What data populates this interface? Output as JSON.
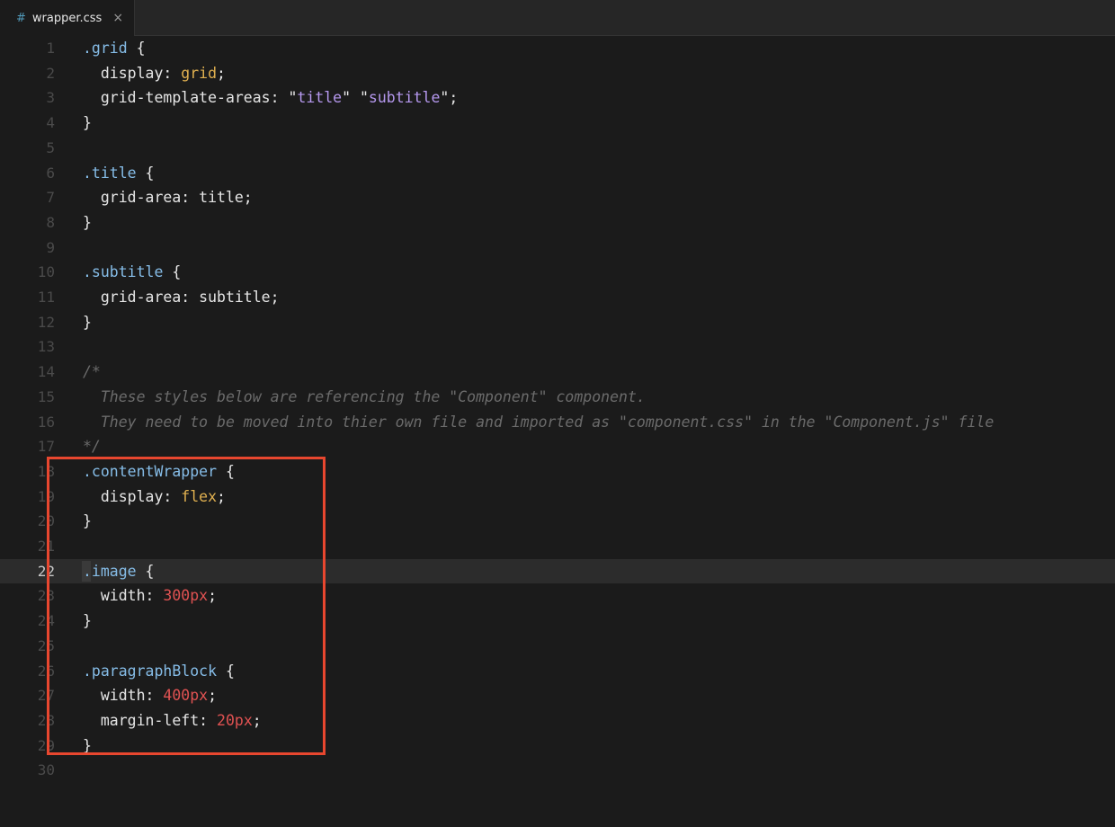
{
  "tab": {
    "icon": "#",
    "filename": "wrapper.css",
    "close": "×"
  },
  "colors": {
    "selector": "#86bde8",
    "keyword": "#e0b050",
    "string": "#b598ee",
    "number": "#e05252",
    "comment": "#6b6b6b",
    "annotation_box": "#e8472f"
  },
  "active_line": 22,
  "lines": [
    {
      "n": "1",
      "tokens": [
        [
          "sel",
          ".grid"
        ],
        [
          "punc",
          " {"
        ]
      ]
    },
    {
      "n": "2",
      "tokens": [
        [
          "prop",
          "  display: "
        ],
        [
          "kw",
          "grid"
        ],
        [
          "punc",
          ";"
        ]
      ]
    },
    {
      "n": "3",
      "tokens": [
        [
          "prop",
          "  grid-template-areas: "
        ],
        [
          "punc",
          "\""
        ],
        [
          "str",
          "title"
        ],
        [
          "punc",
          "\" \""
        ],
        [
          "str",
          "subtitle"
        ],
        [
          "punc",
          "\";"
        ]
      ]
    },
    {
      "n": "4",
      "tokens": [
        [
          "punc",
          "}"
        ]
      ]
    },
    {
      "n": "5",
      "tokens": []
    },
    {
      "n": "6",
      "tokens": [
        [
          "sel",
          ".title"
        ],
        [
          "punc",
          " {"
        ]
      ]
    },
    {
      "n": "7",
      "tokens": [
        [
          "prop",
          "  grid-area: title;"
        ]
      ]
    },
    {
      "n": "8",
      "tokens": [
        [
          "punc",
          "}"
        ]
      ]
    },
    {
      "n": "9",
      "tokens": []
    },
    {
      "n": "10",
      "tokens": [
        [
          "sel",
          ".subtitle"
        ],
        [
          "punc",
          " {"
        ]
      ]
    },
    {
      "n": "11",
      "tokens": [
        [
          "prop",
          "  grid-area: subtitle;"
        ]
      ]
    },
    {
      "n": "12",
      "tokens": [
        [
          "punc",
          "}"
        ]
      ]
    },
    {
      "n": "13",
      "tokens": []
    },
    {
      "n": "14",
      "tokens": [
        [
          "com",
          "/*"
        ]
      ]
    },
    {
      "n": "15",
      "tokens": [
        [
          "com",
          "  These styles below are referencing the \"Component\" component."
        ]
      ]
    },
    {
      "n": "16",
      "tokens": [
        [
          "com",
          "  They need to be moved into thier own file and imported as \"component.css\" in the \"Component.js\" file"
        ]
      ]
    },
    {
      "n": "17",
      "tokens": [
        [
          "com",
          "*/"
        ]
      ]
    },
    {
      "n": "18",
      "tokens": [
        [
          "sel",
          ".contentWrapper"
        ],
        [
          "punc",
          " {"
        ]
      ]
    },
    {
      "n": "19",
      "tokens": [
        [
          "prop",
          "  display: "
        ],
        [
          "kw",
          "flex"
        ],
        [
          "punc",
          ";"
        ]
      ]
    },
    {
      "n": "20",
      "tokens": [
        [
          "punc",
          "}"
        ]
      ]
    },
    {
      "n": "21",
      "tokens": []
    },
    {
      "n": "22",
      "tokens": [
        [
          "sel",
          ".image"
        ],
        [
          "punc",
          " {"
        ]
      ]
    },
    {
      "n": "23",
      "tokens": [
        [
          "prop",
          "  width: "
        ],
        [
          "num",
          "300px"
        ],
        [
          "punc",
          ";"
        ]
      ]
    },
    {
      "n": "24",
      "tokens": [
        [
          "punc",
          "}"
        ]
      ]
    },
    {
      "n": "25",
      "tokens": []
    },
    {
      "n": "26",
      "tokens": [
        [
          "sel",
          ".paragraphBlock"
        ],
        [
          "punc",
          " {"
        ]
      ]
    },
    {
      "n": "27",
      "tokens": [
        [
          "prop",
          "  width: "
        ],
        [
          "num",
          "400px"
        ],
        [
          "punc",
          ";"
        ]
      ]
    },
    {
      "n": "28",
      "tokens": [
        [
          "prop",
          "  margin-left: "
        ],
        [
          "num",
          "20px"
        ],
        [
          "punc",
          ";"
        ]
      ]
    },
    {
      "n": "29",
      "tokens": [
        [
          "punc",
          "}"
        ]
      ]
    },
    {
      "n": "30",
      "tokens": []
    }
  ]
}
